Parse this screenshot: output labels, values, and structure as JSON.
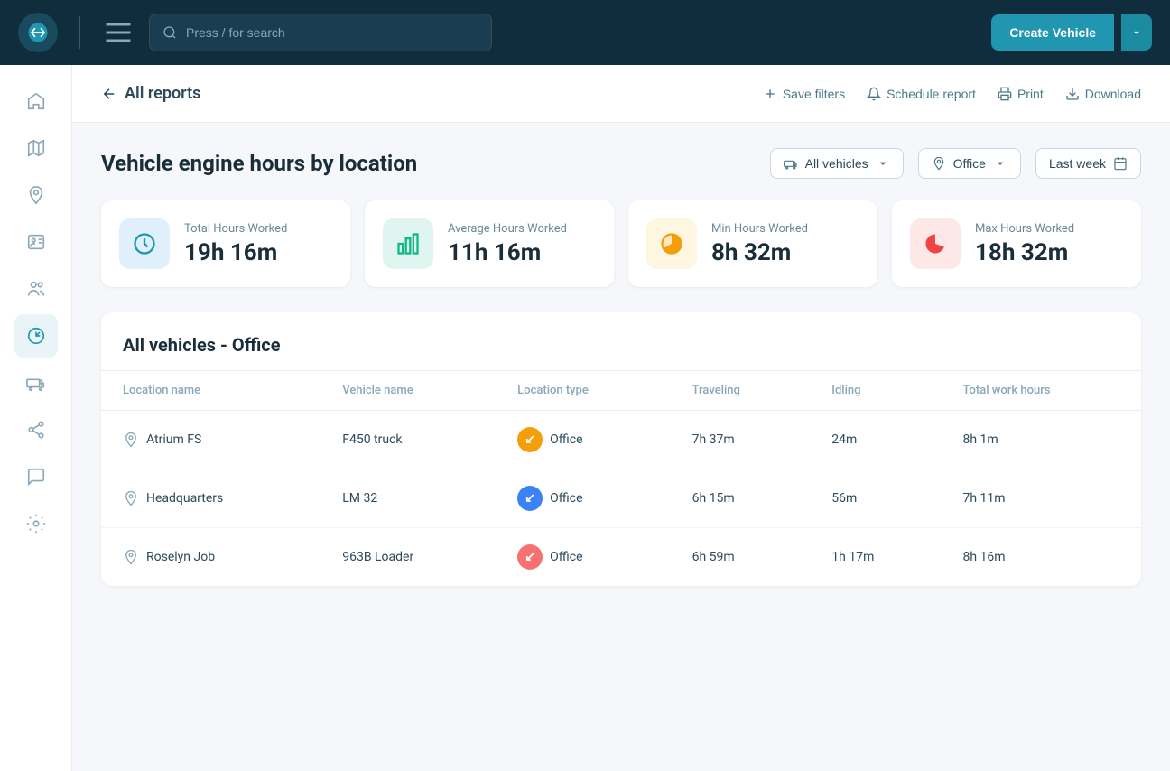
{
  "app": {
    "logo_alt": "Fleetup Logo"
  },
  "topnav": {
    "search_placeholder": "Press / for search",
    "create_btn_label": "Create Vehicle",
    "dropdown_icon": "▾"
  },
  "sidebar": {
    "items": [
      {
        "name": "home",
        "label": "Home",
        "active": false
      },
      {
        "name": "map",
        "label": "Map",
        "active": false
      },
      {
        "name": "location",
        "label": "Location",
        "active": false
      },
      {
        "name": "drivers",
        "label": "Drivers",
        "active": false
      },
      {
        "name": "users",
        "label": "Users",
        "active": false
      },
      {
        "name": "reports",
        "label": "Reports",
        "active": true
      },
      {
        "name": "vehicles",
        "label": "Vehicles",
        "active": false
      },
      {
        "name": "share",
        "label": "Share",
        "active": false
      },
      {
        "name": "messages",
        "label": "Messages",
        "active": false
      },
      {
        "name": "settings",
        "label": "Settings",
        "active": false
      }
    ]
  },
  "page_header": {
    "back_label": "All reports",
    "save_filters_label": "Save filters",
    "schedule_report_label": "Schedule report",
    "print_label": "Print",
    "download_label": "Download"
  },
  "report": {
    "title": "Vehicle engine hours by location",
    "filter_vehicles_label": "All vehicles",
    "filter_location_label": "Office",
    "filter_date_label": "Last week"
  },
  "stats": [
    {
      "label": "Total Hours Worked",
      "value": "19h 16m",
      "color": "blue",
      "icon": "clock"
    },
    {
      "label": "Average Hours Worked",
      "value": "11h 16m",
      "color": "green",
      "icon": "bar-chart"
    },
    {
      "label": "Min Hours Worked",
      "value": "8h 32m",
      "color": "yellow",
      "icon": "pie-chart"
    },
    {
      "label": "Max Hours Worked",
      "value": "18h 32m",
      "color": "red",
      "icon": "pie-full"
    }
  ],
  "table": {
    "section_title": "All vehicles - Office",
    "columns": [
      "Location name",
      "Vehicle name",
      "Location type",
      "Traveling",
      "Idling",
      "Total work hours"
    ],
    "rows": [
      {
        "location_name": "Atrium FS",
        "vehicle_name": "F450 truck",
        "badge_color": "orange",
        "badge_icon": "↙",
        "location_type": "Office",
        "traveling": "7h 37m",
        "idling": "24m",
        "total": "8h 1m"
      },
      {
        "location_name": "Headquarters",
        "vehicle_name": "LM 32",
        "badge_color": "blue",
        "badge_icon": "↙",
        "location_type": "Office",
        "traveling": "6h 15m",
        "idling": "56m",
        "total": "7h 11m"
      },
      {
        "location_name": "Roselyn Job",
        "vehicle_name": "963B Loader",
        "badge_color": "pink",
        "badge_icon": "↙",
        "location_type": "Office",
        "traveling": "6h 59m",
        "idling": "1h 17m",
        "total": "8h 16m"
      }
    ]
  }
}
